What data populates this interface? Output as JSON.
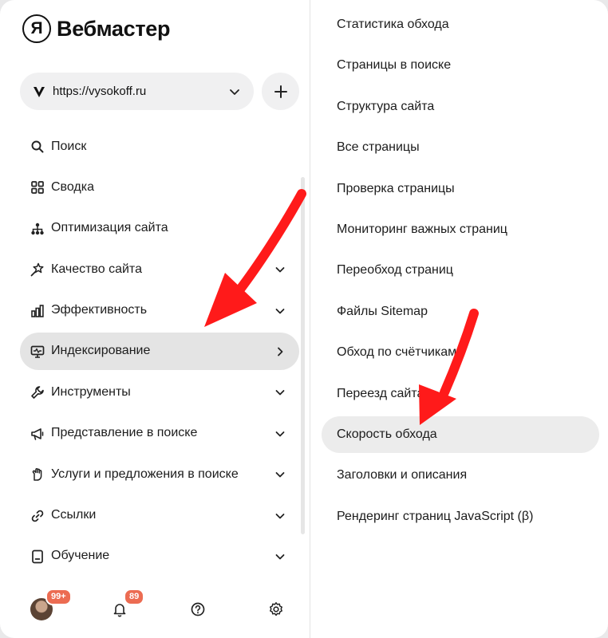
{
  "app": {
    "logo_mark": "Я",
    "logo_text": "Вебмастер"
  },
  "site_selector": {
    "url": "https://vysokoff.ru",
    "favicon": "v-logo-icon"
  },
  "left_menu": [
    {
      "label": "Поиск",
      "icon": "search-icon",
      "chevron": ""
    },
    {
      "label": "Сводка",
      "icon": "grid-icon",
      "chevron": ""
    },
    {
      "label": "Оптимизация сайта",
      "icon": "sitemap-icon",
      "chevron": ""
    },
    {
      "label": "Качество сайта",
      "icon": "star-wand-icon",
      "chevron": "down"
    },
    {
      "label": "Эффективность",
      "icon": "bar-chart-icon",
      "chevron": "down"
    },
    {
      "label": "Индексирование",
      "icon": "monitor-icon",
      "chevron": "right",
      "active": true
    },
    {
      "label": "Инструменты",
      "icon": "wrench-icon",
      "chevron": "down"
    },
    {
      "label": "Представление в поиске",
      "icon": "megaphone-icon",
      "chevron": "down"
    },
    {
      "label": "Услуги и предложения в поиске",
      "icon": "hand-icon",
      "chevron": "down"
    },
    {
      "label": "Ссылки",
      "icon": "link-icon",
      "chevron": "down"
    },
    {
      "label": "Обучение",
      "icon": "book-icon",
      "chevron": "down"
    }
  ],
  "bottom_bar": {
    "avatar_badge": "99+",
    "bell_badge": "89",
    "icons": [
      "avatar",
      "bell-icon",
      "help-icon",
      "settings-icon"
    ]
  },
  "submenu": [
    {
      "label": "Статистика обхода"
    },
    {
      "label": "Страницы в поиске"
    },
    {
      "label": "Структура сайта"
    },
    {
      "label": "Все страницы"
    },
    {
      "label": "Проверка страницы"
    },
    {
      "label": "Мониторинг важных страниц"
    },
    {
      "label": "Переобход страниц"
    },
    {
      "label": "Файлы Sitemap"
    },
    {
      "label": "Обход по счётчикам"
    },
    {
      "label": "Переезд сайта"
    },
    {
      "label": "Скорость обхода",
      "active": true
    },
    {
      "label": "Заголовки и описания"
    },
    {
      "label": "Рендеринг страниц JavaScript (β)"
    }
  ],
  "colors": {
    "accent_arrow": "#ff1a1a",
    "badge": "#ec6c52",
    "active_bg": "#e4e4e4"
  }
}
